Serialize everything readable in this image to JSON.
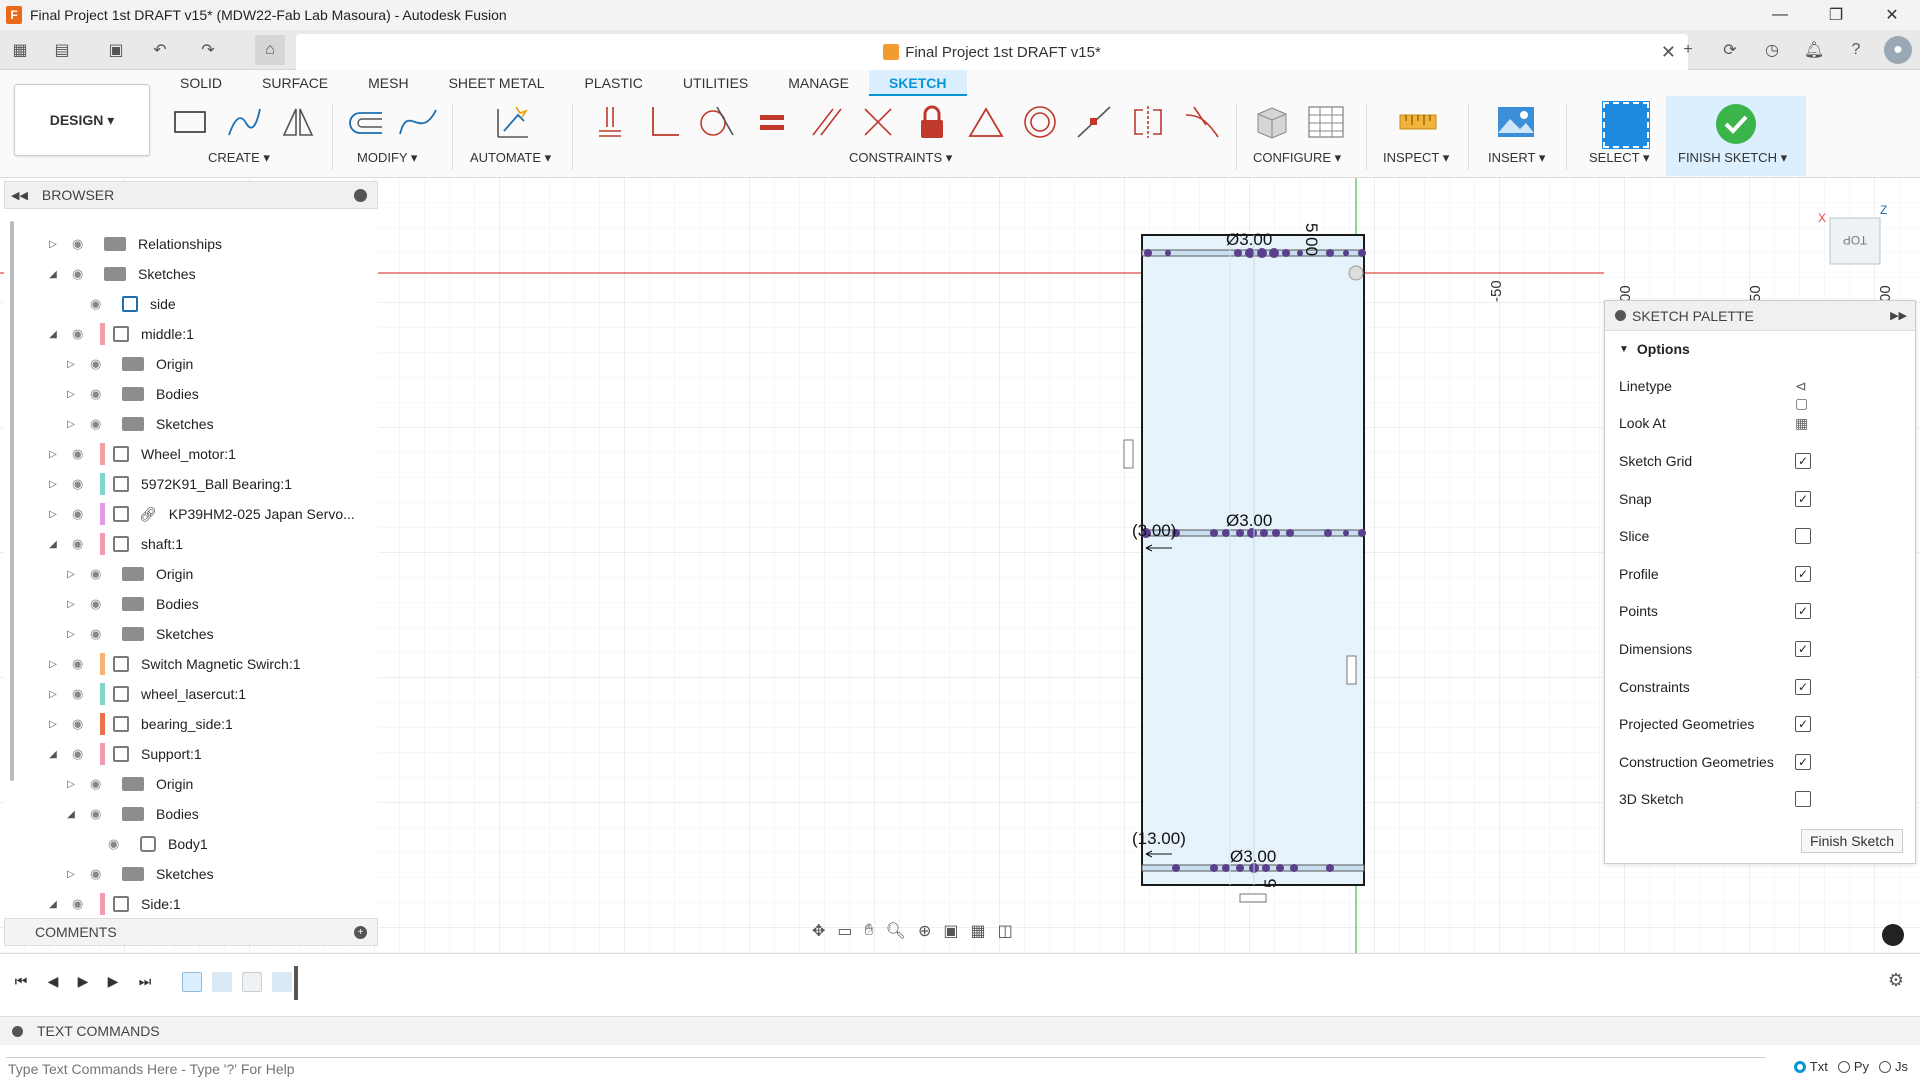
{
  "window": {
    "title": "Final Project 1st DRAFT v15* (MDW22-Fab Lab Masoura) - Autodesk Fusion",
    "minimize": "—",
    "restore": "❐",
    "close": "✕"
  },
  "document_tab": {
    "title": "Final Project 1st DRAFT v15*",
    "close": "✕"
  },
  "ribbon": {
    "workspace": "DESIGN ▾",
    "tabs": [
      "SOLID",
      "SURFACE",
      "MESH",
      "SHEET METAL",
      "PLASTIC",
      "UTILITIES",
      "MANAGE",
      "SKETCH"
    ],
    "active_tab": "SKETCH",
    "groups": {
      "create": "CREATE ▾",
      "modify": "MODIFY ▾",
      "automate": "AUTOMATE ▾",
      "constraints": "CONSTRAINTS ▾",
      "configure": "CONFIGURE ▾",
      "inspect": "INSPECT ▾",
      "insert": "INSERT ▾",
      "select": "SELECT ▾",
      "finish_sketch": "FINISH SKETCH ▾"
    }
  },
  "browser": {
    "title": "BROWSER",
    "items": [
      {
        "label": "Relationships",
        "arrow": "▷"
      },
      {
        "label": "Sketches",
        "arrow": "◢"
      },
      {
        "label": "side",
        "arrow": ""
      },
      {
        "label": "middle:1",
        "arrow": "◢"
      },
      {
        "label": "Origin",
        "arrow": "▷"
      },
      {
        "label": "Bodies",
        "arrow": "▷"
      },
      {
        "label": "Sketches",
        "arrow": "▷"
      },
      {
        "label": "Wheel_motor:1",
        "arrow": "▷"
      },
      {
        "label": "5972K91_Ball Bearing:1",
        "arrow": "▷"
      },
      {
        "label": "KP39HM2-025 Japan Servo...",
        "arrow": "▷"
      },
      {
        "label": "shaft:1",
        "arrow": "◢"
      },
      {
        "label": "Origin",
        "arrow": "▷"
      },
      {
        "label": "Bodies",
        "arrow": "▷"
      },
      {
        "label": "Sketches",
        "arrow": "▷"
      },
      {
        "label": "Switch Magnetic Swirch:1",
        "arrow": "▷"
      },
      {
        "label": "wheel_lasercut:1",
        "arrow": "▷"
      },
      {
        "label": "bearing_side:1",
        "arrow": "▷"
      },
      {
        "label": "Support:1",
        "arrow": "◢"
      },
      {
        "label": "Origin",
        "arrow": "▷"
      },
      {
        "label": "Bodies",
        "arrow": "◢"
      },
      {
        "label": "Body1",
        "arrow": ""
      },
      {
        "label": "Sketches",
        "arrow": "▷"
      },
      {
        "label": "Side:1",
        "arrow": "◢"
      }
    ],
    "swatch_colors": [
      "",
      "",
      "",
      "#f2a0a8",
      "",
      "",
      "",
      "#f5a0a0",
      "#7fd8d0",
      "#e39be8",
      "#f29bb0",
      "",
      "",
      "",
      "#f5b37a",
      "#7fd8c8",
      "#e8704a",
      "#f29bb0",
      "",
      "",
      "",
      "",
      "#f29bb0"
    ]
  },
  "comments": {
    "title": "COMMENTS"
  },
  "canvas": {
    "dimensions": {
      "dia_top": "Ø3.00",
      "dia_mid": "Ø3.00",
      "dia_bot": "Ø3.00",
      "left_mid": "(3.00)",
      "left_bot": "(13.00)",
      "top_vertical": "5.00",
      "bot_vertical": "5"
    },
    "ruler_labels": [
      "-50",
      "00",
      "50",
      "00"
    ],
    "viewcube": "TOP",
    "axis_x": "X",
    "axis_z": "Z"
  },
  "sketch_palette": {
    "title": "SKETCH PALETTE",
    "options_label": "Options",
    "options": [
      {
        "label": "Linetype",
        "kind": "icon"
      },
      {
        "label": "Look At",
        "kind": "icon"
      },
      {
        "label": "Sketch Grid",
        "kind": "check",
        "checked": true
      },
      {
        "label": "Snap",
        "kind": "check",
        "checked": true
      },
      {
        "label": "Slice",
        "kind": "check",
        "checked": false
      },
      {
        "label": "Profile",
        "kind": "check",
        "checked": true
      },
      {
        "label": "Points",
        "kind": "check",
        "checked": true
      },
      {
        "label": "Dimensions",
        "kind": "check",
        "checked": true
      },
      {
        "label": "Constraints",
        "kind": "check",
        "checked": true
      },
      {
        "label": "Projected Geometries",
        "kind": "check",
        "checked": true
      },
      {
        "label": "Construction Geometries",
        "kind": "check",
        "checked": true
      },
      {
        "label": "3D Sketch",
        "kind": "check",
        "checked": false
      }
    ],
    "finish_button": "Finish Sketch"
  },
  "text_commands": {
    "title": "TEXT COMMANDS",
    "placeholder": "Type Text Commands Here - Type '?' For Help",
    "modes": [
      "Txt",
      "Py",
      "Js"
    ],
    "selected_mode": "Txt"
  },
  "colors": {
    "accent": "#0696d7",
    "sketch_fill": "#e6f3fa",
    "sketch_line": "#1a1a1a",
    "red_axis": "#e04848",
    "green_axis": "#3fbf3f",
    "constraint_purple": "#8a4fd6"
  }
}
